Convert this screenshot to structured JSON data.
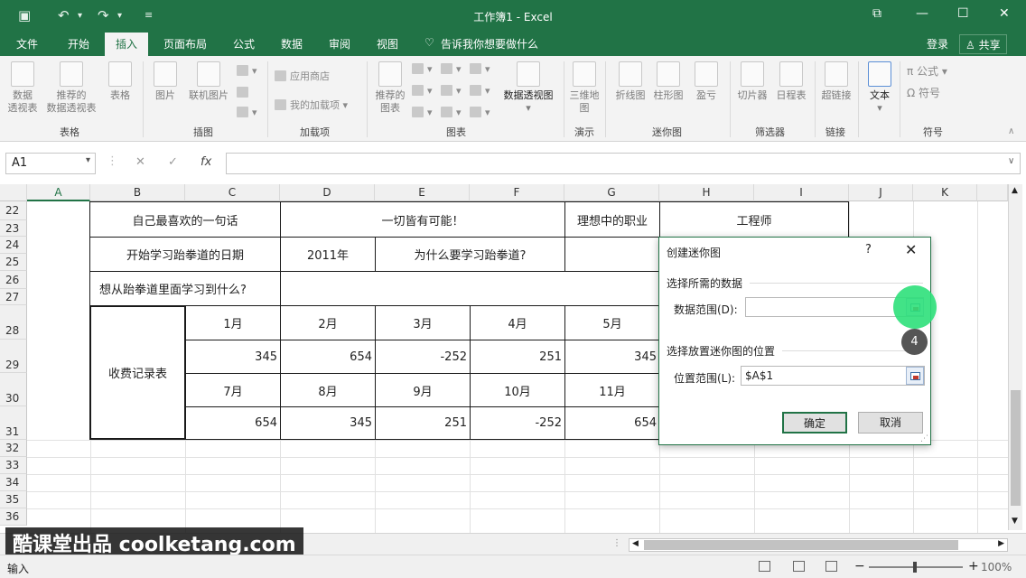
{
  "app": {
    "title": "工作簿1 - Excel"
  },
  "tabs": [
    "文件",
    "开始",
    "插入",
    "页面布局",
    "公式",
    "数据",
    "审阅",
    "视图"
  ],
  "tell_me": "告诉我你想要做什么",
  "account": {
    "login": "登录",
    "share": "共享"
  },
  "ribbon": {
    "buttons": {
      "pivot": "数据\n透视表",
      "rec_pivot": "推荐的\n数据透视表",
      "table": "表格",
      "picture": "图片",
      "online_pic": "联机图片",
      "app_store": "应用商店",
      "my_addins": "我的加载项",
      "rec_charts": "推荐的\n图表",
      "pivot_chart": "数据透视图",
      "map3d": "三维地\n图",
      "line": "折线图",
      "column": "柱形图",
      "winloss": "盈亏",
      "slicer": "切片器",
      "timeline": "日程表",
      "hyperlink": "超链接",
      "text": "文本",
      "equation": "公式",
      "symbol": "符号"
    },
    "groups": {
      "tables": "表格",
      "illustrations": "插图",
      "addins": "加载项",
      "charts": "图表",
      "tours": "演示",
      "sparklines": "迷你图",
      "filters": "筛选器",
      "links": "链接",
      "symbols": "符号"
    }
  },
  "formula_bar": {
    "name_box": "A1",
    "fx": "fx",
    "cancel": "✕",
    "enter": "✓"
  },
  "columns": [
    "A",
    "B",
    "C",
    "D",
    "E",
    "F",
    "G",
    "H",
    "I",
    "J",
    "K"
  ],
  "rows": [
    "22",
    "23",
    "24",
    "25",
    "26",
    "27",
    "28",
    "29",
    "30",
    "31",
    "32",
    "33",
    "34",
    "35",
    "36"
  ],
  "cells": {
    "favorite_quote_label": "自己最喜欢的一句话",
    "favorite_quote": "一切皆有可能！",
    "ideal_job_label": "理想中的职业",
    "ideal_job": "工程师",
    "start_date_label": "开始学习跆拳道的日期",
    "start_year": "2011年",
    "why_label": "为什么要学习跆拳道?",
    "learn_label": "想从跆拳道里面学习到什么?",
    "fee_label": "收费记录表",
    "months_row1": [
      "1月",
      "2月",
      "3月",
      "4月",
      "5月"
    ],
    "values_row1": [
      "345",
      "654",
      "-252",
      "251",
      "345"
    ],
    "months_row2": [
      "7月",
      "8月",
      "9月",
      "10月",
      "11月"
    ],
    "values_row2": [
      "654",
      "345",
      "251",
      "-252",
      "654"
    ]
  },
  "dialog": {
    "title": "创建迷你图",
    "help": "?",
    "close": "✕",
    "section_data": "选择所需的数据",
    "data_range_label": "数据范围(D):",
    "data_range_value": "",
    "section_location": "选择放置迷你图的位置",
    "location_label": "位置范围(L):",
    "location_value": "$A$1",
    "ok": "确定",
    "cancel": "取消"
  },
  "step_badge": "4",
  "watermark": "酷课堂出品 coolketang.com",
  "status": {
    "mode": "输入",
    "zoom": "100%"
  }
}
